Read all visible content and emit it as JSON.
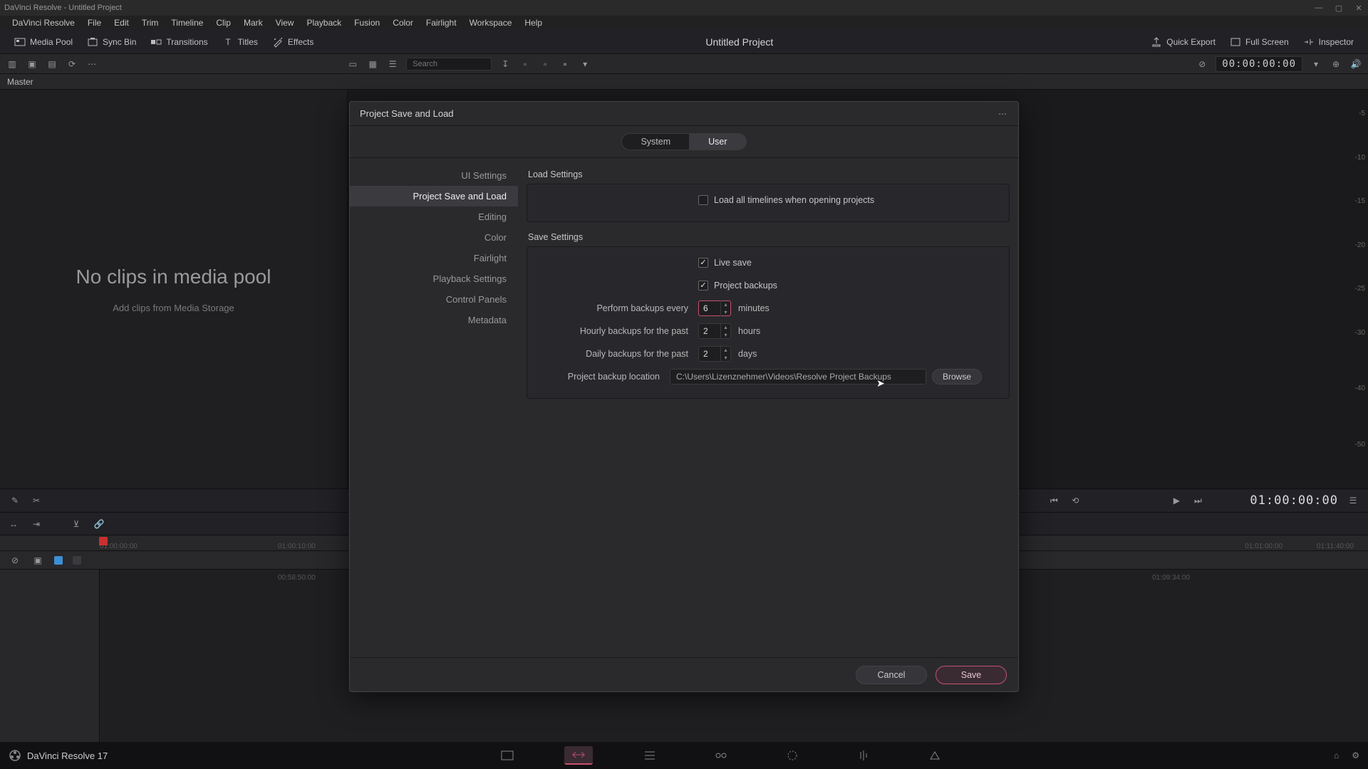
{
  "app": {
    "title": "DaVinci Resolve - Untitled Project",
    "project_name": "Untitled Project"
  },
  "menu": [
    "DaVinci Resolve",
    "File",
    "Edit",
    "Trim",
    "Timeline",
    "Clip",
    "Mark",
    "View",
    "Playback",
    "Fusion",
    "Color",
    "Fairlight",
    "Workspace",
    "Help"
  ],
  "toolbar": {
    "media_pool": "Media Pool",
    "sync_bin": "Sync Bin",
    "transitions": "Transitions",
    "titles": "Titles",
    "effects": "Effects",
    "quick_export": "Quick Export",
    "full_screen": "Full Screen",
    "inspector": "Inspector"
  },
  "subtoolbar": {
    "search_placeholder": "Search",
    "timecode": "00:00:00:00"
  },
  "master": {
    "label": "Master"
  },
  "media": {
    "no_clips": "No clips in media pool",
    "add_clips": "Add clips from Media Storage"
  },
  "db_marks": [
    "-5",
    "-10",
    "-15",
    "-20",
    "-25",
    "-30",
    "-40",
    "-50"
  ],
  "timeline": {
    "tc_left": "01:00:00:00",
    "tc_right": "01:00:00:00",
    "ticks": [
      "01:00:00:00",
      "01:00:10:00"
    ],
    "rtick_a": "01:01:00:00",
    "rtick_b": "01:11:40:00",
    "tr_a": "00:58:50:00",
    "tr_b": "01:09:34:00"
  },
  "bottom": {
    "app_name": "DaVinci Resolve 17"
  },
  "dialog": {
    "title": "Project Save and Load",
    "tabs": {
      "system": "System",
      "user": "User"
    },
    "sidebar": [
      "UI Settings",
      "Project Save and Load",
      "Editing",
      "Color",
      "Fairlight",
      "Playback Settings",
      "Control Panels",
      "Metadata"
    ],
    "load_settings": {
      "title": "Load Settings",
      "load_all": "Load all timelines when opening projects"
    },
    "save_settings": {
      "title": "Save Settings",
      "live_save": "Live save",
      "project_backups": "Project backups",
      "perform_label": "Perform backups every",
      "perform_val": "6",
      "perform_unit": "minutes",
      "hourly_label": "Hourly backups for the past",
      "hourly_val": "2",
      "hourly_unit": "hours",
      "daily_label": "Daily backups for the past",
      "daily_val": "2",
      "daily_unit": "days",
      "location_label": "Project backup location",
      "location_path": "C:\\Users\\Lizenznehmer\\Videos\\Resolve Project Backups",
      "browse": "Browse"
    },
    "footer": {
      "cancel": "Cancel",
      "save": "Save"
    }
  }
}
